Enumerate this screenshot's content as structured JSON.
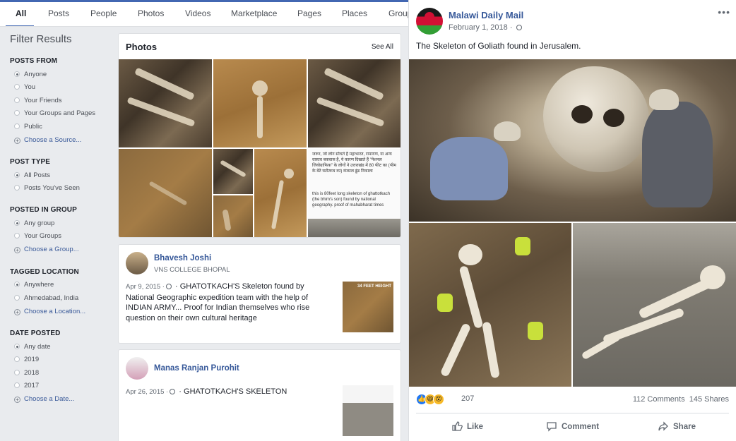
{
  "tabs": [
    {
      "label": "All",
      "active": true
    },
    {
      "label": "Posts"
    },
    {
      "label": "People"
    },
    {
      "label": "Photos"
    },
    {
      "label": "Videos"
    },
    {
      "label": "Marketplace"
    },
    {
      "label": "Pages"
    },
    {
      "label": "Places"
    },
    {
      "label": "Groups"
    }
  ],
  "sidebar": {
    "title": "Filter Results",
    "sections": [
      {
        "heading": "POSTS FROM",
        "options": [
          "Anyone",
          "You",
          "Your Friends",
          "Your Groups and Pages",
          "Public"
        ],
        "selected": 0,
        "choose": "Choose a Source..."
      },
      {
        "heading": "POST TYPE",
        "options": [
          "All Posts",
          "Posts You've Seen"
        ],
        "selected": 0
      },
      {
        "heading": "POSTED IN GROUP",
        "options": [
          "Any group",
          "Your Groups"
        ],
        "selected": 0,
        "choose": "Choose a Group..."
      },
      {
        "heading": "TAGGED LOCATION",
        "options": [
          "Anywhere",
          "Ahmedabad, India"
        ],
        "selected": 0,
        "choose": "Choose a Location..."
      },
      {
        "heading": "DATE POSTED",
        "options": [
          "Any date",
          "2019",
          "2018",
          "2017"
        ],
        "selected": 0,
        "choose": "Choose a Date..."
      }
    ]
  },
  "photos": {
    "title": "Photos",
    "see_all": "See All",
    "note_text": "जरूर, जो लोग सोचते हैं महाभारत, रामायण, या अन्य वास्तव बकवास है, ये कारण दिखाते हैं \"नेशनल जियोग्राफिक\" के लोगों ने उत्तराखंड में 80 फीट का (भीम के बेटे घटोत्कच का) कंकाल ढूंढ निकाला",
    "note_caption": "this is 80feet long skeleton of ghattotkach (the bhim's son) found by national geography. proof of mahabharat times"
  },
  "posts": [
    {
      "author": "Bhavesh Joshi",
      "subtitle": "VNS COLLEGE BHOPAL",
      "date": "Apr 9, 2015 ·",
      "separator": "·",
      "text": "GHATOTKACH'S Skeleton found by National Geographic expedition team with the help of INDIAN ARMY... Proof for Indian themselves who rise question on their own cultural heritage",
      "thumb_label": "34 FEET HEIGHT"
    },
    {
      "author": "Manas Ranjan Purohit",
      "date": "Apr 26, 2015 ·",
      "separator": "·",
      "text": "GHATOTKACH'S SKELETON"
    }
  ],
  "main_post": {
    "author": "Malawi Daily Mail",
    "date": "February 1, 2018 ·",
    "text": "The Skeleton of Goliath found in Jerusalem.",
    "more": "•••",
    "reaction_count": "207",
    "comments": "112 Comments",
    "shares": "145 Shares",
    "actions": {
      "like": "Like",
      "comment": "Comment",
      "share": "Share"
    }
  },
  "colors": {
    "accent": "#4267b2",
    "link": "#365899",
    "background": "#e9ebee"
  }
}
